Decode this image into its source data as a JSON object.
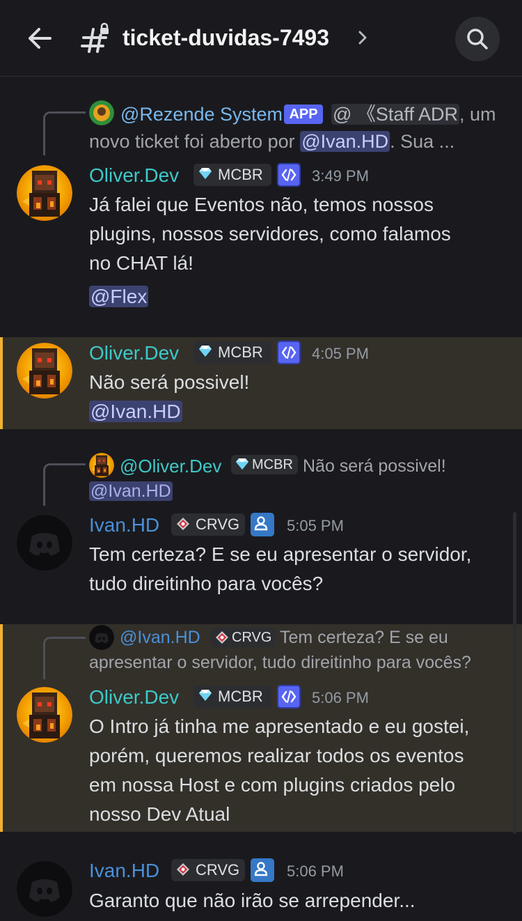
{
  "header": {
    "channel_name": "ticket-duvidas-7493"
  },
  "colors": {
    "oliver": "#3ec9c9",
    "ivan": "#4a90d9",
    "rezende": "#7ab8ec",
    "mention_bg": "#3c4270",
    "highlight_bar": "#f0b232"
  },
  "icons": {
    "back": "arrow-left-icon",
    "channel": "text-channel-locked-icon",
    "chevron": "chevron-right-icon",
    "search": "search-icon"
  },
  "messages": [
    {
      "reply": {
        "author": "@Rezende System",
        "app_badge": "APP",
        "role_mention": "@ 《Staff ADR",
        "text_1": ", um",
        "text_2": "novo ticket foi aberto por",
        "mention": "@Ivan.HD",
        "text_3": ". Sua ..."
      },
      "author": "Oliver.Dev",
      "tag": "MCBR",
      "time": "3:49 PM",
      "lines": [
        "Já falei que Eventos não, temos nossos",
        "plugins, nossos servidores, como falamos",
        "no CHAT lá!"
      ],
      "mention": "@Flex"
    },
    {
      "author": "Oliver.Dev",
      "tag": "MCBR",
      "time": "4:05 PM",
      "lines": [
        "Não será possivel!"
      ],
      "mention": "@Ivan.HD"
    },
    {
      "reply": {
        "author": "@Oliver.Dev",
        "tag": "MCBR",
        "text": "Não será possivel!",
        "mention": "@Ivan.HD"
      },
      "author": "Ivan.HD",
      "tag": "CRVG",
      "time": "5:05 PM",
      "lines": [
        "Tem certeza? E se eu apresentar o servidor,",
        "tudo direitinho para vocês?"
      ]
    },
    {
      "reply": {
        "author": "@Ivan.HD",
        "tag": "CRVG",
        "text_1": "Tem certeza? E se eu",
        "text_2": "apresentar o servidor, tudo direitinho para vocês?"
      },
      "author": "Oliver.Dev",
      "tag": "MCBR",
      "time": "5:06 PM",
      "lines": [
        "O Intro já tinha me apresentado e eu gostei,",
        "porém, queremos realizar todos os eventos",
        "em nossa Host e com plugins criados pelo",
        "nosso Dev Atual"
      ]
    },
    {
      "author": "Ivan.HD",
      "tag": "CRVG",
      "time": "5:06 PM",
      "lines": [
        "Garanto que não irão se arrepender..."
      ]
    }
  ]
}
